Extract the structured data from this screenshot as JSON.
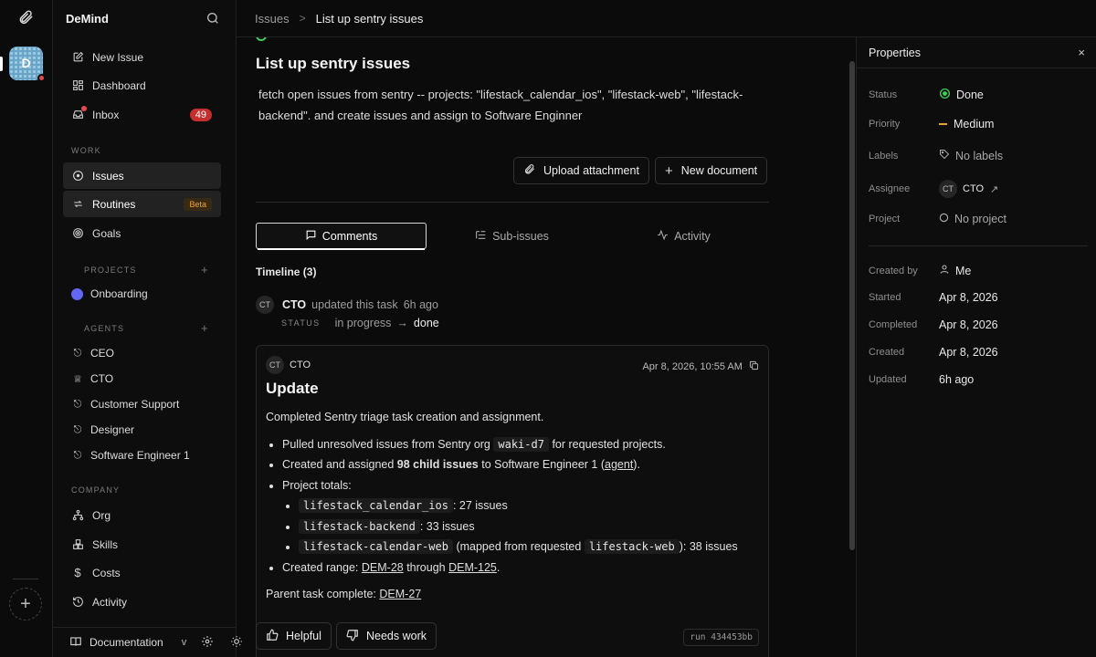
{
  "app": {
    "name": "DeMind",
    "workspace_initial": "D"
  },
  "sidebar": {
    "top_items": [
      {
        "label": "New Issue",
        "icon": "pencil-square-icon"
      },
      {
        "label": "Dashboard",
        "icon": "dashboard-grid-icon"
      },
      {
        "label": "Inbox",
        "icon": "inbox-icon",
        "badge": "49"
      }
    ],
    "work_label": "WORK",
    "work_items": [
      {
        "label": "Issues",
        "icon": "circle-dot-icon",
        "active": true
      },
      {
        "label": "Routines",
        "icon": "repeat-icon",
        "badge": "Beta"
      },
      {
        "label": "Goals",
        "icon": "target-icon"
      }
    ],
    "projects_label": "PROJECTS",
    "projects": [
      {
        "label": "Onboarding",
        "color": "#6366f1"
      }
    ],
    "agents_label": "AGENTS",
    "agents": [
      {
        "label": "CEO",
        "icon": "bot-icon"
      },
      {
        "label": "CTO",
        "icon": "crown-icon"
      },
      {
        "label": "Customer Support",
        "icon": "bot-icon"
      },
      {
        "label": "Designer",
        "icon": "bot-icon"
      },
      {
        "label": "Software Engineer 1",
        "icon": "bot-icon"
      }
    ],
    "company_label": "COMPANY",
    "company_items": [
      {
        "label": "Org",
        "icon": "org-chart-icon"
      },
      {
        "label": "Skills",
        "icon": "boxes-icon"
      },
      {
        "label": "Costs",
        "icon": "dollar-icon"
      },
      {
        "label": "Activity",
        "icon": "history-icon"
      }
    ],
    "footer": {
      "label": "Documentation",
      "chevron": "v"
    }
  },
  "breadcrumb": {
    "parent": "Issues",
    "separator": ">",
    "current": "List up sentry issues"
  },
  "issue": {
    "title": "List up sentry issues",
    "description": "fetch open issues from sentry -- projects: \"lifestack_calendar_ios\", \"lifestack-web\", \"lifestack-backend\". and create issues and assign to Software Enginner",
    "upload_label": "Upload attachment",
    "new_doc_label": "New document"
  },
  "tabs": [
    {
      "label": "Comments",
      "icon": "comment-icon",
      "active": true
    },
    {
      "label": "Sub-issues",
      "icon": "list-tree-icon"
    },
    {
      "label": "Activity",
      "icon": "pulse-icon"
    }
  ],
  "timeline": {
    "title": "Timeline (3)",
    "event": {
      "avatar": "CT",
      "actor": "CTO",
      "action": "updated this task",
      "time": "6h ago",
      "status_label": "STATUS",
      "from": "in progress",
      "to": "done"
    }
  },
  "comment": {
    "avatar": "CT",
    "author": "CTO",
    "timestamp": "Apr 8, 2026, 10:55 AM",
    "heading": "Update",
    "intro": "Completed Sentry triage task creation and assignment.",
    "b1_pre": "Pulled unresolved issues from Sentry org",
    "b1_code": "waki-d7",
    "b1_post": "for requested projects.",
    "b2_pre": "Created and assigned",
    "b2_bold": "98 child issues",
    "b2_mid": "to Software Engineer 1 (",
    "b2_link": "agent",
    "b2_post": ").",
    "b3": "Project totals:",
    "p1_code": "lifestack_calendar_ios",
    "p1_text": ": 27 issues",
    "p2_code": "lifestack-backend",
    "p2_text": ": 33 issues",
    "p3_code": "lifestack-calendar-web",
    "p3_mid": "(mapped from requested",
    "p3_code2": "lifestack-web",
    "p3_text": "): 38 issues",
    "b4_pre": "Created range:",
    "b4_link1": "DEM-28",
    "b4_mid": "through",
    "b4_link2": "DEM-125",
    "b4_post": ".",
    "parent_pre": "Parent task complete:",
    "parent_link": "DEM-27",
    "helpful_label": "Helpful",
    "needs_work_label": "Needs work",
    "run_id": "run 434453bb"
  },
  "properties": {
    "title": "Properties",
    "close": "×",
    "status": {
      "label": "Status",
      "value": "Done",
      "color": "#3ecf5a"
    },
    "priority": {
      "label": "Priority",
      "value": "Medium",
      "color": "#e0a03c"
    },
    "labels": {
      "label": "Labels",
      "value": "No labels"
    },
    "assignee": {
      "label": "Assignee",
      "avatar": "CT",
      "value": "CTO"
    },
    "project": {
      "label": "Project",
      "value": "No project"
    },
    "created_by": {
      "label": "Created by",
      "value": "Me"
    },
    "started": {
      "label": "Started",
      "value": "Apr 8, 2026"
    },
    "completed": {
      "label": "Completed",
      "value": "Apr 8, 2026"
    },
    "created": {
      "label": "Created",
      "value": "Apr 8, 2026"
    },
    "updated": {
      "label": "Updated",
      "value": "6h ago"
    }
  }
}
